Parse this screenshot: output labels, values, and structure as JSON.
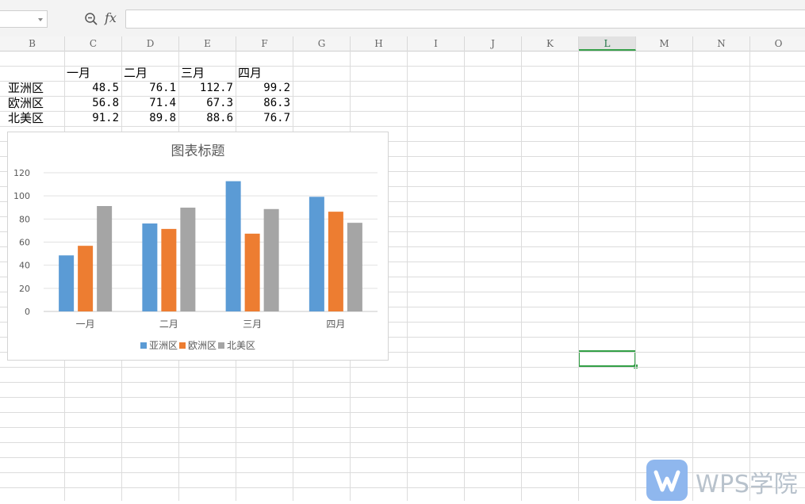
{
  "formula_bar": {
    "zoom_icon": "zoom-icon",
    "fx_label": "fx",
    "formula_value": ""
  },
  "column_headers": [
    "B",
    "C",
    "D",
    "E",
    "F",
    "G",
    "H",
    "I",
    "J",
    "K",
    "L",
    "M",
    "N",
    "O"
  ],
  "selected_column": "L",
  "table": {
    "headers": [
      "一月",
      "二月",
      "三月",
      "四月"
    ],
    "rows": [
      {
        "label": "亚洲区",
        "values": [
          "48.5",
          "76.1",
          "112.7",
          "99.2"
        ]
      },
      {
        "label": "欧洲区",
        "values": [
          "56.8",
          "71.4",
          "67.3",
          "86.3"
        ]
      },
      {
        "label": "北美区",
        "values": [
          "91.2",
          "89.8",
          "88.6",
          "76.7"
        ]
      }
    ]
  },
  "chart_data": {
    "type": "bar",
    "title": "图表标题",
    "categories": [
      "一月",
      "二月",
      "三月",
      "四月"
    ],
    "series": [
      {
        "name": "亚洲区",
        "values": [
          48.5,
          76.1,
          112.7,
          99.2
        ],
        "color": "#5b9bd5"
      },
      {
        "name": "欧洲区",
        "values": [
          56.8,
          71.4,
          67.3,
          86.3
        ],
        "color": "#ed7d31"
      },
      {
        "name": "北美区",
        "values": [
          91.2,
          89.8,
          88.6,
          76.7
        ],
        "color": "#a5a5a5"
      }
    ],
    "ylim": [
      0,
      120
    ],
    "yticks": [
      0,
      20,
      40,
      60,
      80,
      100,
      120
    ],
    "grid": true,
    "legend": "bottom",
    "xlabel": "",
    "ylabel": ""
  },
  "watermark": {
    "text": "WPS学院",
    "logo_icon": "wps-logo-icon"
  }
}
